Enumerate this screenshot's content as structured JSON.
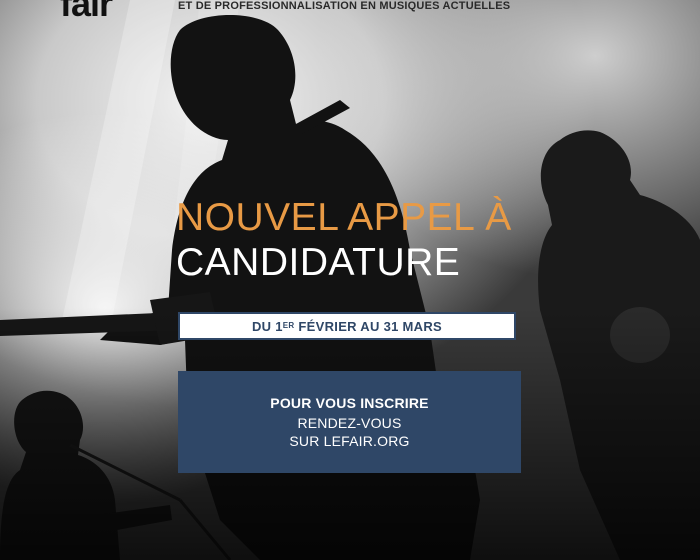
{
  "brand": {
    "logo_text": "fair",
    "tagline": "ET DE PROFESSIONNALISATION EN MUSIQUES ACTUELLES"
  },
  "headline": {
    "line1": "NOUVEL APPEL À",
    "line2": "CANDIDATURE"
  },
  "dates": {
    "prefix": "DU 1",
    "superscript": "ER",
    "suffix": " FÉVRIER AU 31 MARS"
  },
  "cta": {
    "title": "POUR VOUS INSCRIRE",
    "line1": "RENDEZ-VOUS",
    "line2": "SUR LEFAIR.ORG"
  },
  "colors": {
    "accent_orange": "#e89a45",
    "navy": "#2f4767",
    "white": "#ffffff"
  }
}
